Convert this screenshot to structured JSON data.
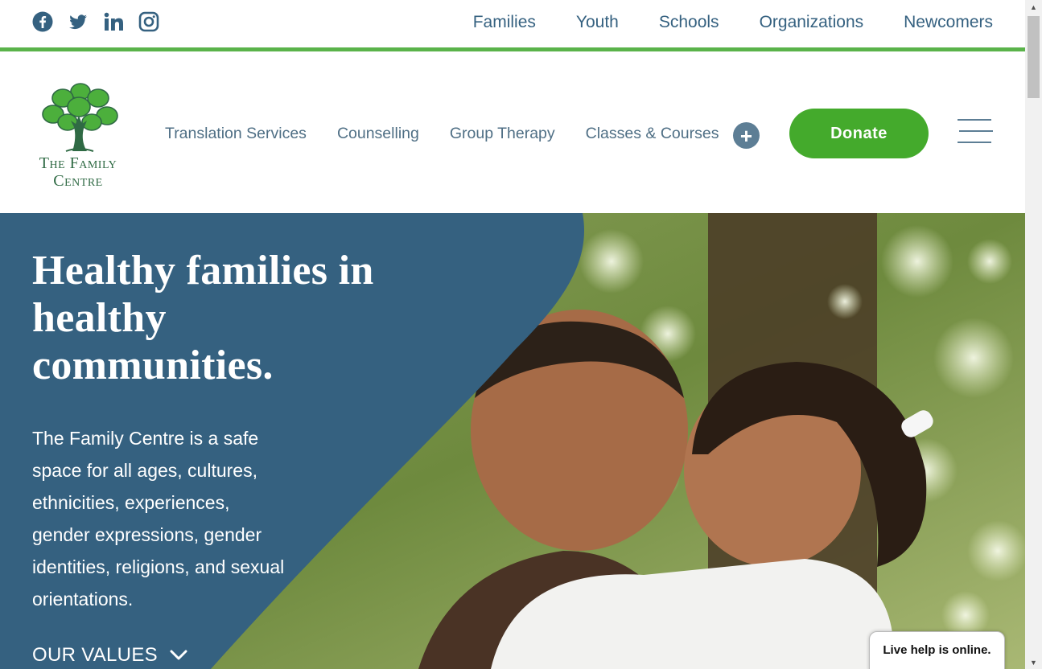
{
  "social": {
    "icons": [
      "facebook-icon",
      "twitter-icon",
      "linkedin-icon",
      "instagram-icon"
    ]
  },
  "topnav": {
    "items": [
      "Families",
      "Youth",
      "Schools",
      "Organizations",
      "Newcomers"
    ]
  },
  "logo": {
    "line1": "The Family",
    "line2": "Centre"
  },
  "mainnav": {
    "items": [
      "Translation Services",
      "Counselling",
      "Group Therapy",
      "Classes & Courses"
    ],
    "expand_symbol": "+"
  },
  "donate": {
    "label": "Donate"
  },
  "hero": {
    "title": "Healthy families in healthy communities.",
    "description": "The Family Centre is a safe space for all ages, cultures, ethnicities, experiences, gender expressions, gender identities, religions, and sexual orientations.",
    "values_label": "OUR VALUES"
  },
  "livehelp": {
    "label": "Live help is online."
  },
  "colors": {
    "brand_blue": "#356180",
    "brand_green": "#44aa2c",
    "accent_line": "#5ab34a"
  }
}
